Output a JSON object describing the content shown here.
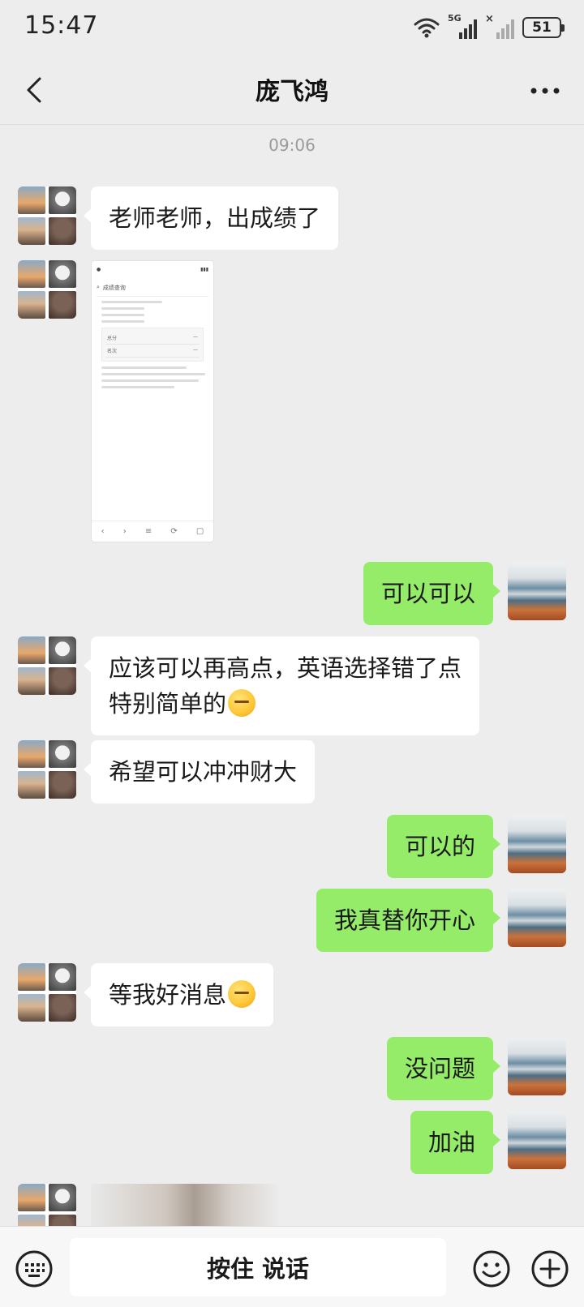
{
  "status_bar": {
    "time": "15:47",
    "network_label": "5G",
    "battery": "51"
  },
  "header": {
    "title": "庞飞鸿",
    "back_icon": "chevron-left-icon",
    "more_icon": "more-horizontal-icon"
  },
  "chat": {
    "timestamp": "09:06",
    "messages": [
      {
        "side": "left",
        "type": "text",
        "text": "老师老师，出成绩了"
      },
      {
        "side": "left",
        "type": "image",
        "alt": "成绩截图"
      },
      {
        "side": "right",
        "type": "text",
        "text": "可以可以"
      },
      {
        "side": "left",
        "type": "text",
        "text": "应该可以再高点，英语选择错了点\n特别简单的",
        "emoji": "sad-face-emoji"
      },
      {
        "side": "left",
        "type": "text",
        "text": "希望可以冲冲财大"
      },
      {
        "side": "right",
        "type": "text",
        "text": "可以的"
      },
      {
        "side": "right",
        "type": "text",
        "text": "我真替你开心"
      },
      {
        "side": "left",
        "type": "text",
        "text": "等我好消息",
        "emoji": "smirk-emoji"
      },
      {
        "side": "right",
        "type": "text",
        "text": "没问题"
      },
      {
        "side": "right",
        "type": "text",
        "text": "加油"
      }
    ]
  },
  "screenshot_thumb": {
    "search_text": "成绩查询",
    "rows": [
      {
        "label": "总分",
        "value": "—"
      },
      {
        "label": "名次",
        "value": "—"
      }
    ]
  },
  "input_bar": {
    "hold_to_talk": "按住 说话",
    "keyboard_icon": "keyboard-icon",
    "emoji_icon": "emoji-icon",
    "plus_icon": "plus-circle-icon"
  },
  "colors": {
    "background": "#ededed",
    "my_bubble": "#95ec69",
    "their_bubble": "#ffffff"
  }
}
